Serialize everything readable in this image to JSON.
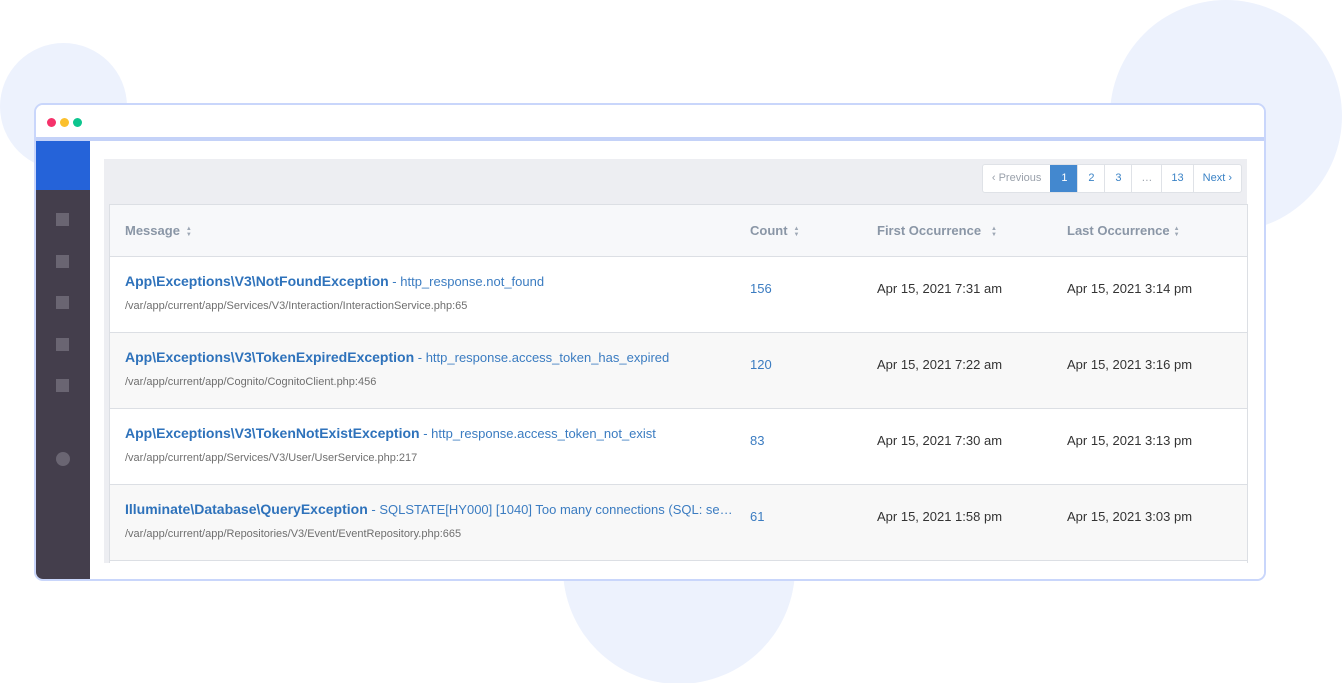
{
  "window": {
    "controls": [
      "close",
      "minimize",
      "maximize"
    ]
  },
  "sidebar": {
    "items": [
      {
        "icon": "square-icon"
      },
      {
        "icon": "square-icon"
      },
      {
        "icon": "square-icon"
      },
      {
        "icon": "square-icon"
      },
      {
        "icon": "square-icon"
      },
      {
        "icon": "circle-icon"
      }
    ]
  },
  "pagination": {
    "previous": "‹ Previous",
    "pages": [
      "1",
      "2",
      "3",
      "…",
      "13"
    ],
    "active_page": "1",
    "next": "Next ›"
  },
  "table": {
    "columns": [
      {
        "label": "Message",
        "sort_icon": "sort-icon"
      },
      {
        "label": "Count",
        "sort_icon": "sort-icon"
      },
      {
        "label": "First Occurrence",
        "sort_icon": "sort-icon"
      },
      {
        "label": "Last Occurrence",
        "sort_icon": "sort-icon"
      }
    ],
    "rows": [
      {
        "exception": "App\\Exceptions\\V3\\NotFoundException",
        "separator": " - ",
        "message": "http_response.not_found",
        "file": "/var/app/current/app/Services/V3/Interaction/InteractionService.php:65",
        "count": "156",
        "first": "Apr 15, 2021 7:31 am",
        "last": "Apr 15, 2021 3:14 pm"
      },
      {
        "exception": "App\\Exceptions\\V3\\TokenExpiredException",
        "separator": " - ",
        "message": "http_response.access_token_has_expired",
        "file": "/var/app/current/app/Cognito/CognitoClient.php:456",
        "count": "120",
        "first": "Apr 15, 2021 7:22 am",
        "last": "Apr 15, 2021 3:16 pm"
      },
      {
        "exception": "App\\Exceptions\\V3\\TokenNotExistException",
        "separator": " - ",
        "message": "http_response.access_token_not_exist",
        "file": "/var/app/current/app/Services/V3/User/UserService.php:217",
        "count": "83",
        "first": "Apr 15, 2021 7:30 am",
        "last": "Apr 15, 2021 3:13 pm"
      },
      {
        "exception": "Illuminate\\Database\\QueryException",
        "separator": " - ",
        "message": "SQLSTATE[HY000] [1040] Too many connections (SQL: sele…",
        "file": "/var/app/current/app/Repositories/V3/Event/EventRepository.php:665",
        "count": "61",
        "first": "Apr 15, 2021 1:58 pm",
        "last": "Apr 15, 2021 3:03 pm"
      }
    ]
  },
  "colors": {
    "brand": "#2563d9",
    "sidebar": "#443e4c",
    "link": "#2e72bb",
    "active_page": "#4388cf"
  }
}
